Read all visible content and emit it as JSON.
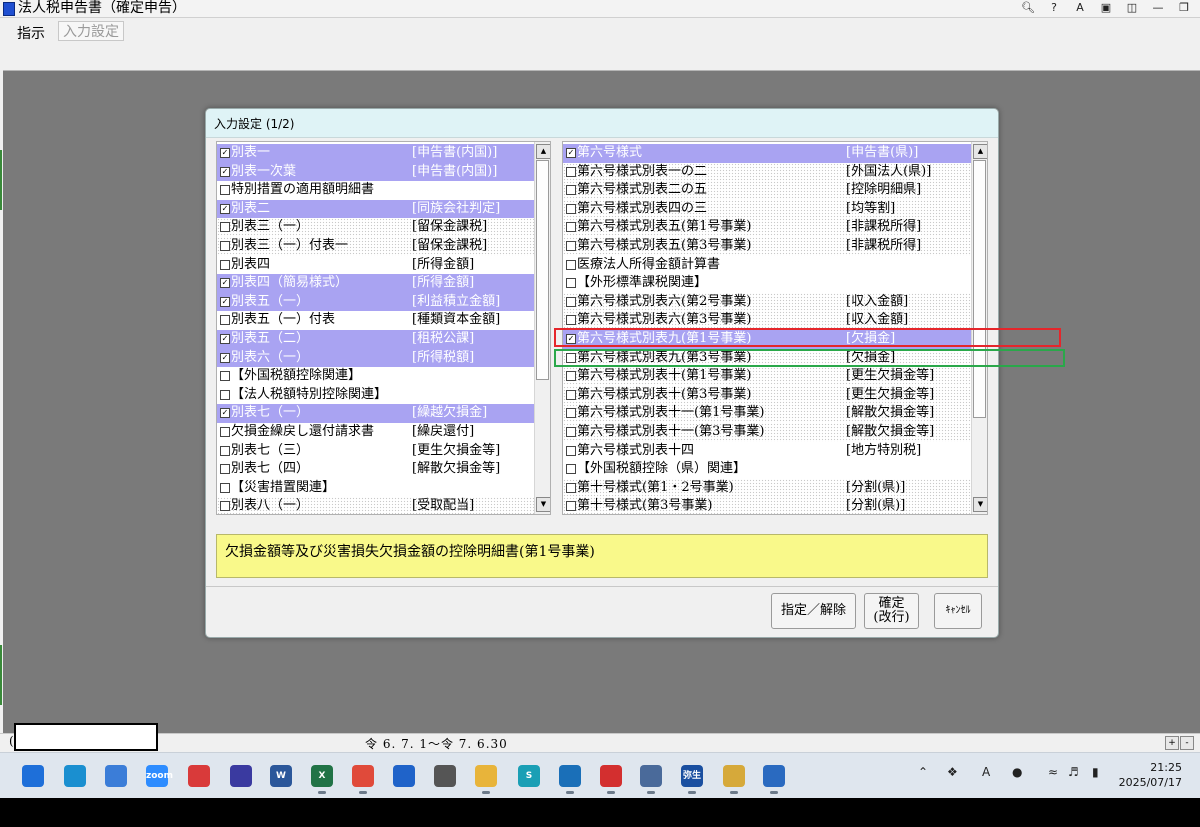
{
  "window": {
    "title": "法人税申告書（確定申告）",
    "menu_instruction": "指示",
    "menu_input": "入力設定",
    "status_paren": "(",
    "status_period": "令 6. 7. 1～令 7. 6.30"
  },
  "dialog": {
    "title": "入力設定 (1/2)",
    "left_list": [
      {
        "checked": true,
        "selected": true,
        "dotted": false,
        "name": "別表一",
        "code": "[申告書(内国)]"
      },
      {
        "checked": true,
        "selected": true,
        "dotted": false,
        "name": "別表一次葉",
        "code": "[申告書(内国)]"
      },
      {
        "checked": false,
        "selected": false,
        "dotted": false,
        "name": "特別措置の適用額明細書",
        "code": ""
      },
      {
        "checked": true,
        "selected": true,
        "dotted": false,
        "name": "別表二",
        "code": "[同族会社判定]"
      },
      {
        "checked": false,
        "selected": false,
        "dotted": true,
        "name": "別表三（一）",
        "code": "[留保金課税]"
      },
      {
        "checked": false,
        "selected": false,
        "dotted": true,
        "name": "別表三（一）付表一",
        "code": "[留保金課税]"
      },
      {
        "checked": false,
        "selected": false,
        "dotted": false,
        "name": "別表四",
        "code": "[所得金額]"
      },
      {
        "checked": true,
        "selected": true,
        "dotted": false,
        "name": "別表四（簡易様式）",
        "code": "[所得金額]"
      },
      {
        "checked": true,
        "selected": true,
        "dotted": false,
        "name": "別表五（一）",
        "code": "[利益積立金額]"
      },
      {
        "checked": false,
        "selected": false,
        "dotted": false,
        "name": "別表五（一）付表",
        "code": "[種類資本金額]"
      },
      {
        "checked": true,
        "selected": true,
        "dotted": false,
        "name": "別表五（二）",
        "code": "[租税公課]"
      },
      {
        "checked": true,
        "selected": true,
        "dotted": false,
        "name": "別表六（一）",
        "code": "[所得税額]"
      },
      {
        "checked": false,
        "selected": false,
        "dotted": false,
        "name": "【外国税額控除関連】",
        "code": ""
      },
      {
        "checked": false,
        "selected": false,
        "dotted": false,
        "name": "【法人税額特別控除関連】",
        "code": ""
      },
      {
        "checked": true,
        "selected": true,
        "dotted": false,
        "name": "別表七（一）",
        "code": "[繰越欠損金]"
      },
      {
        "checked": false,
        "selected": false,
        "dotted": false,
        "name": "欠損金繰戻し還付請求書",
        "code": "[繰戻還付]"
      },
      {
        "checked": false,
        "selected": false,
        "dotted": false,
        "name": "別表七（三）",
        "code": "[更生欠損金等]"
      },
      {
        "checked": false,
        "selected": false,
        "dotted": false,
        "name": "別表七（四）",
        "code": "[解散欠損金等]"
      },
      {
        "checked": false,
        "selected": false,
        "dotted": false,
        "name": "【災害措置関連】",
        "code": ""
      },
      {
        "checked": false,
        "selected": false,
        "dotted": true,
        "name": "別表八（一）",
        "code": "[受取配当]"
      }
    ],
    "right_list": [
      {
        "checked": true,
        "selected": true,
        "dotted": false,
        "name": "第六号様式",
        "code": "[申告書(県)]"
      },
      {
        "checked": false,
        "selected": false,
        "dotted": true,
        "name": "第六号様式別表一の二",
        "code": "[外国法人(県)]"
      },
      {
        "checked": false,
        "selected": false,
        "dotted": true,
        "name": "第六号様式別表二の五",
        "code": "[控除明細県]"
      },
      {
        "checked": false,
        "selected": false,
        "dotted": true,
        "name": "第六号様式別表四の三",
        "code": "[均等割]"
      },
      {
        "checked": false,
        "selected": false,
        "dotted": true,
        "name": "第六号様式別表五(第1号事業)",
        "code": "[非課税所得]"
      },
      {
        "checked": false,
        "selected": false,
        "dotted": true,
        "name": "第六号様式別表五(第3号事業)",
        "code": "[非課税所得]"
      },
      {
        "checked": false,
        "selected": false,
        "dotted": false,
        "name": "医療法人所得金額計算書",
        "code": ""
      },
      {
        "checked": false,
        "selected": false,
        "dotted": false,
        "name": "【外形標準課税関連】",
        "code": ""
      },
      {
        "checked": false,
        "selected": false,
        "dotted": true,
        "name": "第六号様式別表六(第2号事業)",
        "code": "[収入金額]"
      },
      {
        "checked": false,
        "selected": false,
        "dotted": true,
        "name": "第六号様式別表六(第3号事業)",
        "code": "[収入金額]"
      },
      {
        "checked": true,
        "selected": true,
        "dotted": false,
        "name": "第六号様式別表九(第1号事業)",
        "code": "[欠損金]"
      },
      {
        "checked": false,
        "selected": false,
        "dotted": true,
        "name": "第六号様式別表九(第3号事業)",
        "code": "[欠損金]"
      },
      {
        "checked": false,
        "selected": false,
        "dotted": true,
        "name": "第六号様式別表十(第1号事業)",
        "code": "[更生欠損金等]"
      },
      {
        "checked": false,
        "selected": false,
        "dotted": true,
        "name": "第六号様式別表十(第3号事業)",
        "code": "[更生欠損金等]"
      },
      {
        "checked": false,
        "selected": false,
        "dotted": true,
        "name": "第六号様式別表十一(第1号事業)",
        "code": "[解散欠損金等]"
      },
      {
        "checked": false,
        "selected": false,
        "dotted": true,
        "name": "第六号様式別表十一(第3号事業)",
        "code": "[解散欠損金等]"
      },
      {
        "checked": false,
        "selected": false,
        "dotted": false,
        "name": "第六号様式別表十四",
        "code": "[地方特別税]"
      },
      {
        "checked": false,
        "selected": false,
        "dotted": false,
        "name": "【外国税額控除（県）関連】",
        "code": ""
      },
      {
        "checked": false,
        "selected": false,
        "dotted": true,
        "name": "第十号様式(第1・2号事業)",
        "code": "[分割(県)]"
      },
      {
        "checked": false,
        "selected": false,
        "dotted": true,
        "name": "第十号様式(第3号事業)",
        "code": "[分割(県)]"
      }
    ],
    "description": "欠損金額等及び災害損失欠損金額の控除明細書(第1号事業)",
    "buttons": {
      "designate": "指定／解除",
      "confirm_line1": "確定",
      "confirm_line2": "(改行)",
      "cancel": "ｷｬﾝｾﾙ"
    }
  },
  "taskbar": {
    "apps": [
      {
        "icon": "windows-start-icon",
        "label": "",
        "color": "#1e6fd9"
      },
      {
        "icon": "edge-icon",
        "label": "",
        "color": "#1a8fd0"
      },
      {
        "icon": "paint-icon",
        "label": "",
        "color": "#3b7dd8"
      },
      {
        "icon": "zoom-icon",
        "label": "zoom",
        "color": "#2d8cff"
      },
      {
        "icon": "app-red-icon",
        "label": "",
        "color": "#d93a3a"
      },
      {
        "icon": "app-glyph-icon",
        "label": "",
        "color": "#3a3aa0"
      },
      {
        "icon": "word-icon",
        "label": "W",
        "color": "#2b579a"
      },
      {
        "icon": "excel-icon",
        "label": "X",
        "color": "#217346"
      },
      {
        "icon": "chrome-icon",
        "label": "",
        "color": "#e04a3a"
      },
      {
        "icon": "mail-icon",
        "label": "",
        "color": "#1f63c9"
      },
      {
        "icon": "pen-icon",
        "label": "",
        "color": "#555555"
      },
      {
        "icon": "folder-icon",
        "label": "",
        "color": "#e8b43a"
      },
      {
        "icon": "app-s-icon",
        "label": "S",
        "color": "#1a9fb5"
      },
      {
        "icon": "arrow-app-icon",
        "label": "",
        "color": "#1a6fb8"
      },
      {
        "icon": "pdf-icon",
        "label": "",
        "color": "#d32f2f"
      },
      {
        "icon": "viewer-icon",
        "label": "",
        "color": "#4a6a9a"
      },
      {
        "icon": "yayoi-icon",
        "label": "弥生",
        "color": "#1a4fa0"
      },
      {
        "icon": "folder-edit-icon",
        "label": "",
        "color": "#d6a93a"
      },
      {
        "icon": "tax-app-icon",
        "label": "",
        "color": "#2a6ac0"
      }
    ],
    "tray": {
      "ime": "A"
    },
    "time": "21:25",
    "date": "2025/07/17"
  }
}
